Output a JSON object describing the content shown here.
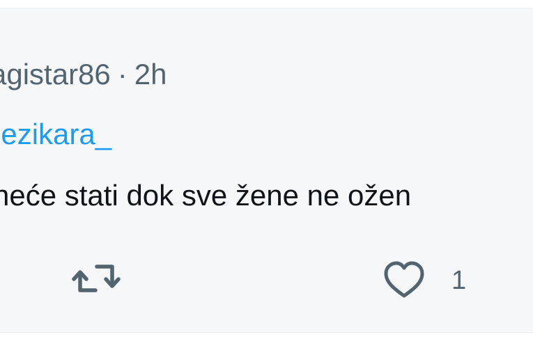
{
  "tweet": {
    "username_partial": "agistar86",
    "separator": "·",
    "time_ago": "2h",
    "replying_to_partial": "jezikara_",
    "text_partial": "neće stati dok sve žene ne ožen"
  },
  "actions": {
    "retweet_icon": "retweet-icon",
    "like_icon": "heart-outline-icon",
    "like_count": "1"
  },
  "colors": {
    "background": "#f6f7f8",
    "secondary_text": "#536471",
    "link": "#1d9bf0",
    "primary_text": "#0f1419"
  }
}
